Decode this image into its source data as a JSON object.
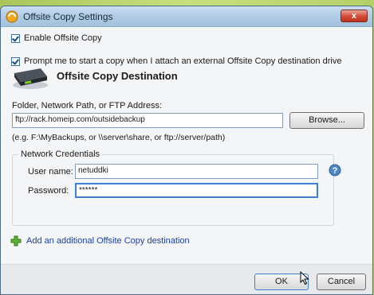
{
  "window": {
    "title": "Offsite Copy Settings",
    "close_label": "x"
  },
  "options": {
    "enable_offsite": {
      "label": "Enable Offsite Copy",
      "checked": true
    },
    "prompt_copy": {
      "label": "Prompt me to start a copy when I attach an external Offsite Copy destination drive",
      "checked": true
    }
  },
  "destination": {
    "heading": "Offsite Copy Destination",
    "address_label": "Folder, Network Path, or FTP Address:",
    "address_value": "ftp://rack.homeip.com/outsidebackup",
    "browse_label": "Browse...",
    "example_text": "(e.g. F:\\MyBackups, or \\\\server\\share, or ftp://server/path)"
  },
  "credentials": {
    "group_title": "Network Credentials",
    "username_label": "User name:",
    "username_value": "netuddki",
    "password_label": "Password:",
    "password_value": "******"
  },
  "add_destination_label": "Add an additional Offsite Copy destination",
  "footer": {
    "ok_label": "OK",
    "cancel_label": "Cancel"
  }
}
